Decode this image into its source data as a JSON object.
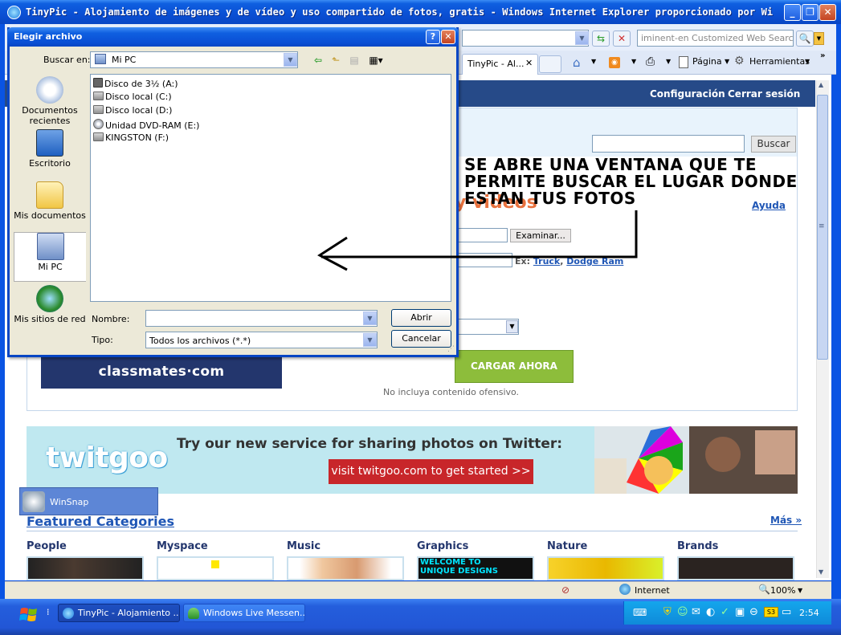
{
  "window": {
    "title": "TinyPic - Alojamiento de imágenes y de vídeo y uso compartido de fotos, gratis - Windows Internet Explorer proporcionado por Wi"
  },
  "browser": {
    "search_placeholder": "iminent-en Customized Web Search",
    "tab_label": "TinyPic - Al...",
    "cmd": {
      "pagina": "Página",
      "herramientas": "Herramientas"
    },
    "status_zone": "Internet",
    "zoom": "100%"
  },
  "site": {
    "header_links": [
      "Configuración",
      "Cerrar sesión"
    ],
    "search_button": "Buscar",
    "upload_heading_visible": "y videos",
    "help_link": "Ayuda",
    "browse_button": "Examinar...",
    "tags_example_prefix": "Ex:",
    "tags_example_1": "Truck",
    "tags_example_2": "Dodge Ram",
    "upload_button": "CARGAR AHORA",
    "upload_note": "No incluya contenido ofensivo.",
    "classmates_ad": "classmates·com",
    "twitgoo": {
      "logo": "twitgoo",
      "tagline": "Try our new service for sharing photos on Twitter:",
      "cta": "visit twitgoo.com to get started  >>"
    },
    "featured_title": "Featured Categories",
    "more_link": "Más »",
    "categories": [
      "People",
      "Myspace",
      "Music",
      "Graphics",
      "Nature",
      "Brands"
    ],
    "graphics_thumb_text": "WELCOME TO UNIQUE DESIGNS"
  },
  "winsnap": {
    "label": "WinSnap"
  },
  "dialog": {
    "title": "Elegir archivo",
    "lookin_label": "Buscar en:",
    "lookin_value": "Mi PC",
    "places": [
      "Documentos recientes",
      "Escritorio",
      "Mis documentos",
      "Mi PC",
      "Mis sitios de red"
    ],
    "drives": [
      "Disco de 3½ (A:)",
      "Disco local (C:)",
      "Disco local (D:)",
      "Unidad DVD-RAM (E:)",
      "KINGSTON (F:)"
    ],
    "name_label": "Nombre:",
    "name_value": "",
    "type_label": "Tipo:",
    "type_value": "Todos los archivos (*.*)",
    "open_button": "Abrir",
    "cancel_button": "Cancelar"
  },
  "annotation": {
    "line1": "SE ABRE UNA VENTANA QUE TE",
    "line2": "PERMITE BUSCAR EL LUGAR DONDE",
    "line3": "ESTAN TUS FOTOS"
  },
  "taskbar": {
    "items": [
      "TinyPic - Alojamiento ...",
      "Windows Live Messen..."
    ],
    "clock": "2:54"
  },
  "colors": {
    "xp_blue": "#0a4fd4",
    "site_header": "#264a88",
    "upload_green": "#8dbd3b",
    "link_blue": "#1f56b5",
    "cta_red": "#c8262a",
    "accent_orange": "#e9723e"
  }
}
